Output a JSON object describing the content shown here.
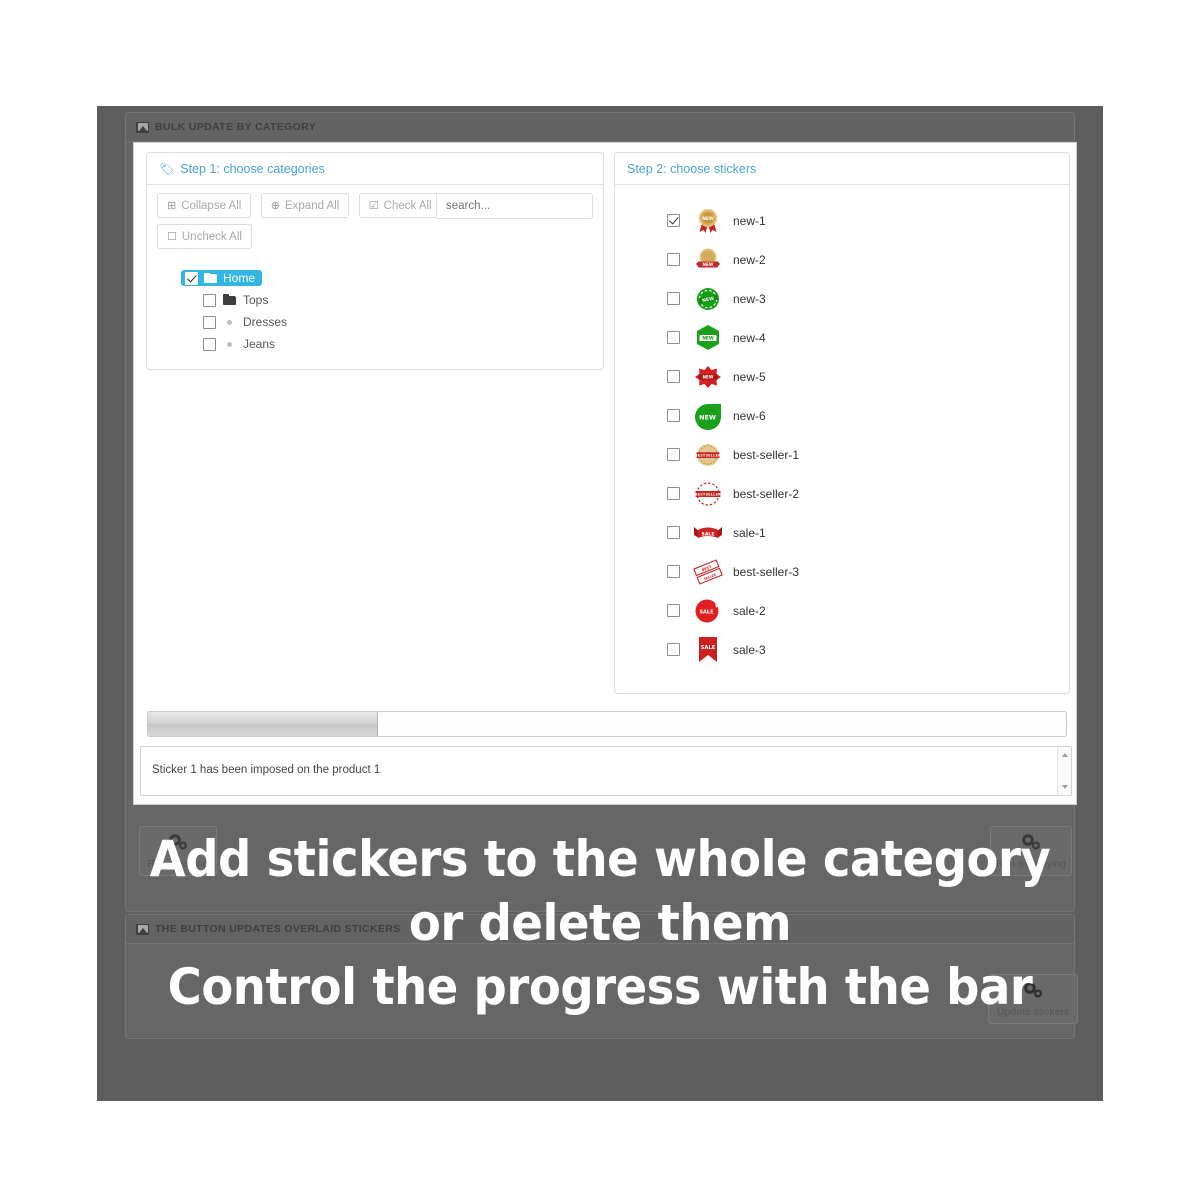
{
  "panels": {
    "top": {
      "title": "BULK UPDATE BY CATEGORY",
      "icon": "picture-icon"
    },
    "bottom": {
      "title": "THE BUTTON UPDATES OVERLAID STICKERS",
      "icon": "picture-icon"
    }
  },
  "step1": {
    "label": "Step 1: choose categories",
    "icon": "tag-icon",
    "buttons": [
      {
        "label": "Collapse All",
        "icon": "minus-square-icon"
      },
      {
        "label": "Expand All",
        "icon": "plus-square-icon"
      },
      {
        "label": "Check All",
        "icon": "checked-square-icon"
      },
      {
        "label": "Uncheck All",
        "icon": "empty-square-icon"
      }
    ],
    "search": {
      "placeholder": "search...",
      "value": ""
    },
    "tree": [
      {
        "label": "Home",
        "checked": true,
        "icon": "folder-open-icon",
        "depth": 0,
        "selected": true
      },
      {
        "label": "Tops",
        "checked": false,
        "icon": "folder-closed-icon",
        "depth": 1,
        "selected": false
      },
      {
        "label": "Dresses",
        "checked": false,
        "icon": "dot-icon",
        "depth": 1,
        "selected": false
      },
      {
        "label": "Jeans",
        "checked": false,
        "icon": "dot-icon",
        "depth": 1,
        "selected": false
      }
    ]
  },
  "step2": {
    "label": "Step 2: choose stickers",
    "stickers": [
      {
        "name": "new-1",
        "checked": true,
        "icon": "gold-medal-new-badge"
      },
      {
        "name": "new-2",
        "checked": false,
        "icon": "gold-seal-new-ribbon"
      },
      {
        "name": "new-3",
        "checked": false,
        "icon": "green-circle-new-stamp"
      },
      {
        "name": "new-4",
        "checked": false,
        "icon": "green-hexagon-new-badge"
      },
      {
        "name": "new-5",
        "checked": false,
        "icon": "red-starburst-new-badge"
      },
      {
        "name": "new-6",
        "checked": false,
        "icon": "green-drop-new-badge"
      },
      {
        "name": "best-seller-1",
        "checked": false,
        "icon": "gold-circle-bestseller-stamp"
      },
      {
        "name": "best-seller-2",
        "checked": false,
        "icon": "red-circle-bestseller-stamp"
      },
      {
        "name": "sale-1",
        "checked": false,
        "icon": "red-banner-sale-ribbon"
      },
      {
        "name": "best-seller-3",
        "checked": false,
        "icon": "red-diagonal-bestseller-ribbons"
      },
      {
        "name": "sale-2",
        "checked": false,
        "icon": "red-circle-sale-sticker"
      },
      {
        "name": "sale-3",
        "checked": false,
        "icon": "red-bookmark-sale-ribbon"
      }
    ],
    "sticker_text": {
      "new": "NEW",
      "sale": "SALE",
      "best_seller": "BESTSELLER"
    }
  },
  "progress": {
    "percent": 25
  },
  "log": {
    "lines": "Sticker 1 has been imposed on the product 1"
  },
  "actions": {
    "run_cleaning": {
      "label": "Run cleaning",
      "icon": "gears-icon"
    },
    "run_overlaying": {
      "label": "Run overlaying",
      "icon": "gears-icon"
    },
    "update_stickers": {
      "label": "Update stickers",
      "icon": "gears-icon"
    }
  },
  "overlay": {
    "line1": "Add stickers to the whole category",
    "line2": "or delete them",
    "line3": "Control the progress with the bar"
  },
  "colors": {
    "accent": "#4aa3d8",
    "selection": "#33b5e5",
    "frame": "#5e5e5e",
    "panel": "#666666"
  }
}
